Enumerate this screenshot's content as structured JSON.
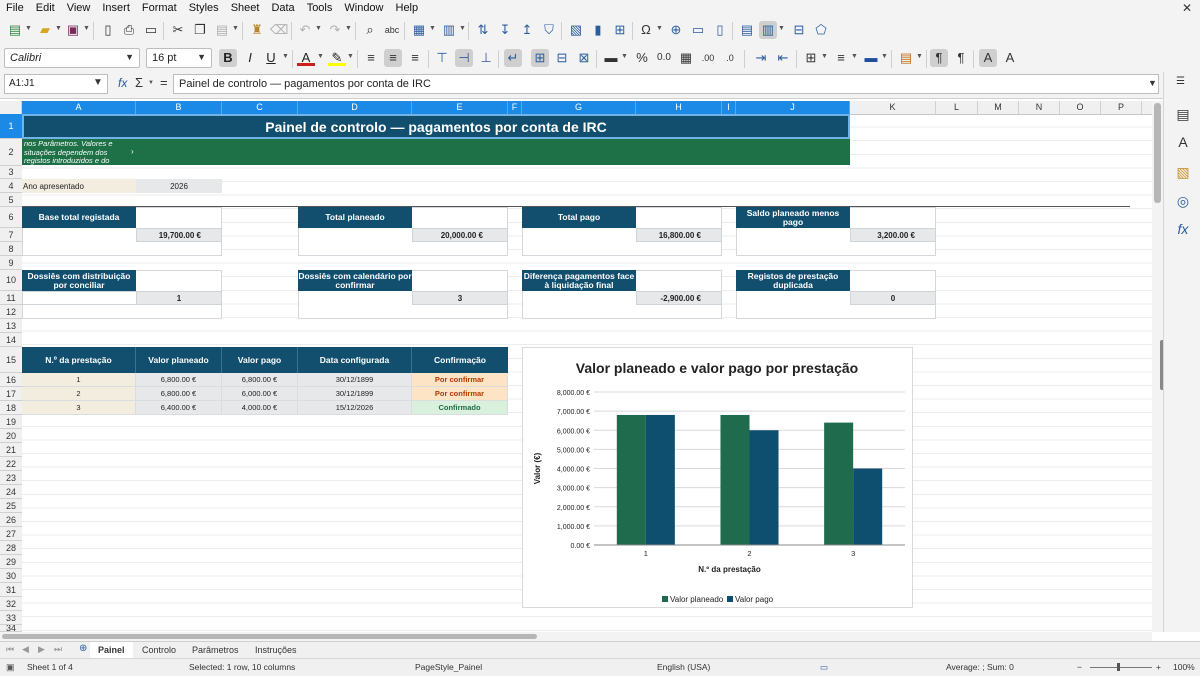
{
  "menu": [
    "File",
    "Edit",
    "View",
    "Insert",
    "Format",
    "Styles",
    "Sheet",
    "Data",
    "Tools",
    "Window",
    "Help"
  ],
  "font_name": "Calibri",
  "font_size": "16 pt",
  "name_box": "A1:J1",
  "formula": "Painel de controlo — pagamentos por conta de IRC",
  "columns": [
    "A",
    "B",
    "C",
    "D",
    "E",
    "F",
    "G",
    "H",
    "I",
    "J",
    "K",
    "L",
    "M",
    "N",
    "O",
    "P"
  ],
  "rows": [
    "1",
    "2",
    "3",
    "4",
    "5",
    "6",
    "7",
    "8",
    "9",
    "10",
    "11",
    "12",
    "13",
    "14",
    "15",
    "16",
    "17",
    "18",
    "19",
    "20",
    "21",
    "22",
    "23",
    "24",
    "25",
    "26",
    "27",
    "28",
    "29",
    "30",
    "31",
    "32",
    "33",
    "34"
  ],
  "title": "Painel de controlo — pagamentos por conta de IRC",
  "note": "nos Parâmetros. Valores e situações dependem dos registos introduzidos e do",
  "note_arrow": "›",
  "year_label": "Ano apresentado",
  "year_value": "2026",
  "kpis_row1": [
    {
      "label": "Base total registada",
      "value": "19,700.00 €"
    },
    {
      "label": "Total planeado",
      "value": "20,000.00 €"
    },
    {
      "label": "Total pago",
      "value": "16,800.00 €"
    },
    {
      "label": "Saldo planeado menos pago",
      "value": "3,200.00 €"
    }
  ],
  "kpis_row2": [
    {
      "label": "Dossiês com distribuição por conciliar",
      "value": "1"
    },
    {
      "label": "Dossiês com calendário por confirmar",
      "value": "3"
    },
    {
      "label": "Diferença pagamentos face à liquidação final",
      "value": "-2,900.00 €"
    },
    {
      "label": "Registos de prestação duplicada",
      "value": "0"
    }
  ],
  "table": {
    "headers": [
      "N.º da prestação",
      "Valor planeado",
      "Valor pago",
      "Data configurada",
      "Confirmação"
    ],
    "rows": [
      [
        "1",
        "6,800.00 €",
        "6,800.00 €",
        "30/12/1899",
        "Por confirmar"
      ],
      [
        "2",
        "6,800.00 €",
        "6,000.00 €",
        "30/12/1899",
        "Por confirmar"
      ],
      [
        "3",
        "6,400.00 €",
        "4,000.00 €",
        "15/12/2026",
        "Confirmado"
      ]
    ]
  },
  "colors": {
    "navy": "#124f6f",
    "green": "#1e7047",
    "series_planned": "#1e6b4d",
    "series_paid": "#0e4f6f",
    "pending_bg": "#fce4c4",
    "pending_text": "#b23b00",
    "confirmed_bg": "#d9f0dc",
    "confirmed_text": "#1e7047",
    "selection": "#1b8ae6"
  },
  "chart_data": {
    "type": "bar",
    "title": "Valor planeado e valor pago por prestação",
    "xlabel": "N.º da prestação",
    "ylabel": "Valor (€)",
    "categories": [
      "1",
      "2",
      "3"
    ],
    "series": [
      {
        "name": "Valor planeado",
        "values": [
          6800,
          6800,
          6400
        ]
      },
      {
        "name": "Valor pago",
        "values": [
          6800,
          6000,
          4000
        ]
      }
    ],
    "ylim": [
      0,
      8000
    ],
    "yticks": [
      "0.00 €",
      "1,000.00 €",
      "2,000.00 €",
      "3,000.00 €",
      "4,000.00 €",
      "5,000.00 €",
      "6,000.00 €",
      "7,000.00 €",
      "8,000.00 €"
    ],
    "grid": true,
    "legend": "bottom"
  },
  "sheets": [
    "Painel",
    "Controlo",
    "Parâmetros",
    "Instruções"
  ],
  "status": {
    "sheet": "Sheet 1 of 4",
    "selection": "Selected: 1 row, 10 columns",
    "page_style": "PageStyle_Painel",
    "language": "English (USA)",
    "summary": "Average: ; Sum: 0",
    "zoom": "100%"
  }
}
